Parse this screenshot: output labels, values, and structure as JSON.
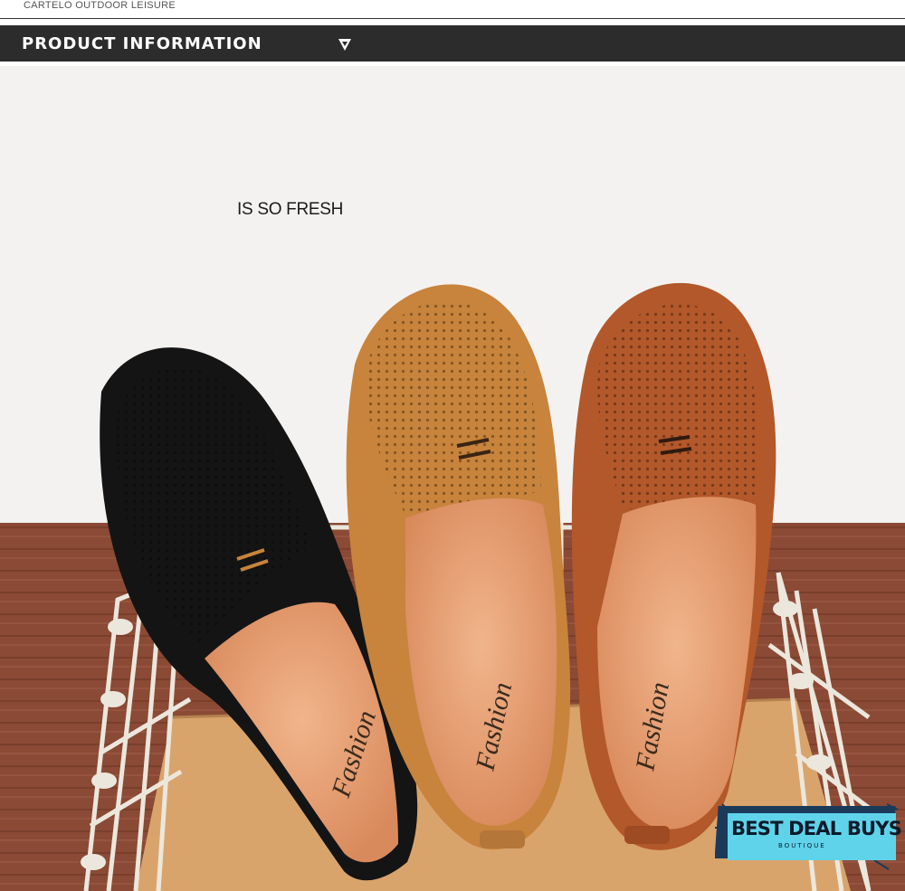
{
  "header": {
    "brand": "CARTELO OUTDOOR LEISURE",
    "section_title": "PRODUCT INFORMATION",
    "section_icon": "chevron-down-triangle-icon"
  },
  "photo": {
    "caption": "IS SO FRESH",
    "insole_text": [
      "Fashion",
      "Fashion",
      "Fashion"
    ],
    "shoe_colors": [
      "#141414",
      "#c8843c",
      "#b3582a"
    ]
  },
  "badge": {
    "title": "BEST DEAL BUYS",
    "subtitle": "BOUTIQUE",
    "accent": "#5fd3ea"
  }
}
